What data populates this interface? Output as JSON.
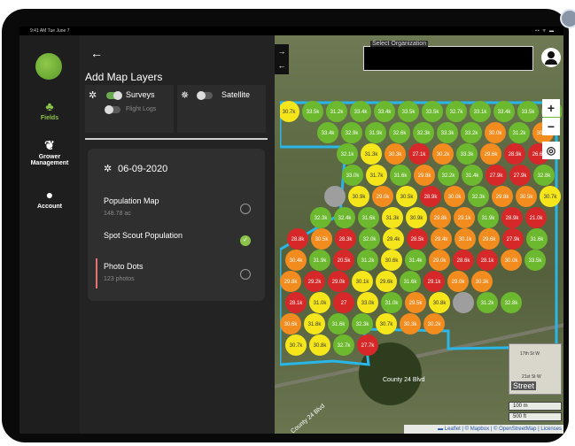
{
  "status_bar": {
    "time": "9:41 AM  Tue June 7",
    "icons": "▪▪ ᯤ ▬"
  },
  "nav": {
    "items": [
      {
        "label": "Fields",
        "icon": "sprout-icon"
      },
      {
        "label": "Grower Management",
        "icon": "paw-icon"
      },
      {
        "label": "Account",
        "icon": "account-icon"
      }
    ]
  },
  "panel": {
    "title": "Add Map Layers",
    "layers": {
      "surveys_label": "Surveys",
      "flight_logs_label": "Flight Logs",
      "satellite_label": "Satellite",
      "surveys_on": true,
      "flight_logs_on": false,
      "satellite_on": false
    },
    "survey": {
      "date": "06-09-2020",
      "items": [
        {
          "title": "Population Map",
          "sub": "148.78 ac",
          "selected": false
        },
        {
          "title": "Spot Scout Population",
          "sub": "",
          "selected": true
        },
        {
          "title": "Photo Dots",
          "sub": "123 photos",
          "selected": false
        }
      ]
    }
  },
  "map": {
    "org_label": "Select Organization",
    "zoom_in": "+",
    "zoom_out": "−",
    "style_label": "Street",
    "street_1": "17th St W",
    "street_2": "21st St W",
    "road_1": "County 24 Blvd",
    "road_2": "County 24 Blvd",
    "scale_m": "100 m",
    "scale_ft": "500 ft",
    "attribution": "▬ Leaflet | © Mapbox | © OpenStreetMap | Licenses",
    "colors": {
      "boundary": "#29b6e8",
      "red": "#d62828",
      "orange": "#f28c1e",
      "yellow": "#f5e61c",
      "green": "#6cb82e",
      "gray": "#9e9e9e"
    },
    "dots": [
      {
        "c": "yellow",
        "t": "30.7k"
      },
      {
        "c": "green",
        "t": "33.5k"
      },
      {
        "c": "green",
        "t": "31.2k"
      },
      {
        "c": "green",
        "t": "33.4k"
      },
      {
        "c": "green",
        "t": "33.4k"
      },
      {
        "c": "green",
        "t": "33.5k"
      },
      {
        "c": "green",
        "t": "33.5k"
      },
      {
        "c": "green",
        "t": "32.7k"
      },
      {
        "c": "green",
        "t": "33.1k"
      },
      {
        "c": "green",
        "t": "33.4k"
      },
      {
        "c": "green",
        "t": "33.5k"
      },
      {
        "c": "green",
        "t": "33.5k"
      },
      {
        "c": "green",
        "t": "33.4k"
      },
      {
        "c": "green",
        "t": "32.9k"
      },
      {
        "c": "green",
        "t": "31.9k"
      },
      {
        "c": "green",
        "t": "32.6k"
      },
      {
        "c": "green",
        "t": "32.3k"
      },
      {
        "c": "green",
        "t": "33.3k"
      },
      {
        "c": "green",
        "t": "33.2k"
      },
      {
        "c": "orange",
        "t": "30.0k"
      },
      {
        "c": "green",
        "t": "31.2k"
      },
      {
        "c": "orange",
        "t": "30.7k"
      },
      {
        "c": "green",
        "t": "32.1k"
      },
      {
        "c": "yellow",
        "t": "31.3k"
      },
      {
        "c": "orange",
        "t": "30.3k"
      },
      {
        "c": "red",
        "t": "27.1k"
      },
      {
        "c": "orange",
        "t": "30.2k"
      },
      {
        "c": "green",
        "t": "33.3k"
      },
      {
        "c": "orange",
        "t": "29.6k"
      },
      {
        "c": "red",
        "t": "28.9k"
      },
      {
        "c": "red",
        "t": "26.6k"
      },
      {
        "c": "green",
        "t": "33.0k"
      },
      {
        "c": "yellow",
        "t": "31.7k"
      },
      {
        "c": "green",
        "t": "31.6k"
      },
      {
        "c": "orange",
        "t": "29.8k"
      },
      {
        "c": "green",
        "t": "32.2k"
      },
      {
        "c": "green",
        "t": "31.4k"
      },
      {
        "c": "red",
        "t": "27.9k"
      },
      {
        "c": "red",
        "t": "27.9k"
      },
      {
        "c": "green",
        "t": "32.8k"
      },
      {
        "c": "gray",
        "t": ""
      },
      {
        "c": "yellow",
        "t": "30.9k"
      },
      {
        "c": "orange",
        "t": "29.0k"
      },
      {
        "c": "yellow",
        "t": "30.5k"
      },
      {
        "c": "red",
        "t": "28.9k"
      },
      {
        "c": "orange",
        "t": "30.0k"
      },
      {
        "c": "green",
        "t": "32.3k"
      },
      {
        "c": "orange",
        "t": "29.8k"
      },
      {
        "c": "orange",
        "t": "30.5k"
      },
      {
        "c": "yellow",
        "t": "30.7k"
      },
      {
        "c": "green",
        "t": "32.3k"
      },
      {
        "c": "green",
        "t": "32.4k"
      },
      {
        "c": "green",
        "t": "31.6k"
      },
      {
        "c": "yellow",
        "t": "31.3k"
      },
      {
        "c": "yellow",
        "t": "30.9k"
      },
      {
        "c": "orange",
        "t": "29.8k"
      },
      {
        "c": "orange",
        "t": "29.1k"
      },
      {
        "c": "green",
        "t": "31.9k"
      },
      {
        "c": "red",
        "t": "28.9k"
      },
      {
        "c": "red",
        "t": "21.0k"
      },
      {
        "c": "orange",
        "t": "30.8k"
      },
      {
        "c": "red",
        "t": "28.8k"
      },
      {
        "c": "orange",
        "t": "30.5k"
      },
      {
        "c": "red",
        "t": "28.3k"
      },
      {
        "c": "green",
        "t": "32.0k"
      },
      {
        "c": "yellow",
        "t": "29.4k"
      },
      {
        "c": "red",
        "t": "28.5k"
      },
      {
        "c": "orange",
        "t": "29.4k"
      },
      {
        "c": "orange",
        "t": "30.1k"
      },
      {
        "c": "orange",
        "t": "29.6k"
      },
      {
        "c": "red",
        "t": "27.9k"
      },
      {
        "c": "green",
        "t": "31.6k"
      },
      {
        "c": "orange",
        "t": "30.4k"
      },
      {
        "c": "green",
        "t": "31.9k"
      },
      {
        "c": "red",
        "t": "20.5k"
      },
      {
        "c": "green",
        "t": "31.2k"
      },
      {
        "c": "yellow",
        "t": "30.6k"
      },
      {
        "c": "green",
        "t": "31.4k"
      },
      {
        "c": "orange",
        "t": "29.0k"
      },
      {
        "c": "red",
        "t": "28.6k"
      },
      {
        "c": "red",
        "t": "28.1k"
      },
      {
        "c": "orange",
        "t": "30.0k"
      },
      {
        "c": "green",
        "t": "33.5k"
      },
      {
        "c": "orange",
        "t": "29.8k"
      },
      {
        "c": "red",
        "t": "29.2k"
      },
      {
        "c": "red",
        "t": "29.0k"
      },
      {
        "c": "yellow",
        "t": "30.1k"
      },
      {
        "c": "yellow",
        "t": "29.6k"
      },
      {
        "c": "green",
        "t": "31.6k"
      },
      {
        "c": "red",
        "t": "29.1k"
      },
      {
        "c": "orange",
        "t": "29.0k"
      },
      {
        "c": "orange",
        "t": "30.3k"
      },
      {
        "c": "red",
        "t": "28.1k"
      },
      {
        "c": "yellow",
        "t": "31.0k"
      },
      {
        "c": "red",
        "t": "27"
      },
      {
        "c": "yellow",
        "t": "33.0k"
      },
      {
        "c": "green",
        "t": "31.0k"
      },
      {
        "c": "orange",
        "t": "29.5k"
      },
      {
        "c": "yellow",
        "t": "30.8k"
      },
      {
        "c": "gray",
        "t": ""
      },
      {
        "c": "green",
        "t": "31.2k"
      },
      {
        "c": "green",
        "t": "32.8k"
      },
      {
        "c": "orange",
        "t": "30.6k"
      },
      {
        "c": "yellow",
        "t": "31.8k"
      },
      {
        "c": "green",
        "t": "31.6k"
      },
      {
        "c": "green",
        "t": "32.3k"
      },
      {
        "c": "yellow",
        "t": "30.7k"
      },
      {
        "c": "orange",
        "t": "30.3k"
      },
      {
        "c": "orange",
        "t": "30.2k"
      },
      {
        "c": "yellow",
        "t": "30.7k"
      },
      {
        "c": "yellow",
        "t": "30.8k"
      },
      {
        "c": "green",
        "t": "32.7k"
      },
      {
        "c": "red",
        "t": "27.7k"
      }
    ]
  }
}
